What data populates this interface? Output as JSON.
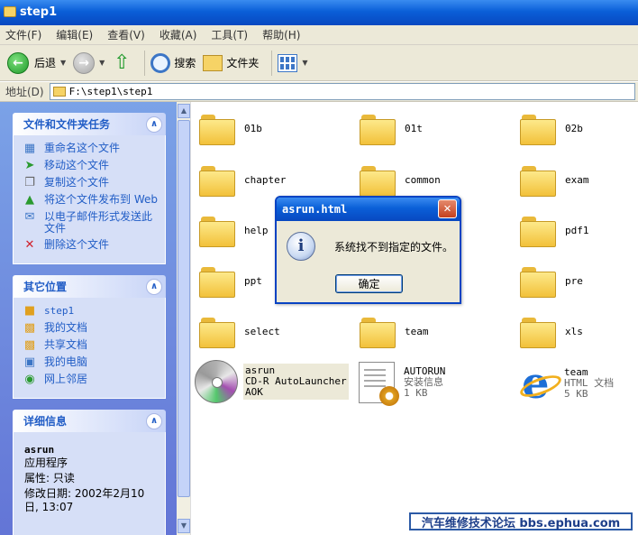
{
  "window": {
    "title": "step1"
  },
  "menu": [
    "文件(F)",
    "编辑(E)",
    "查看(V)",
    "收藏(A)",
    "工具(T)",
    "帮助(H)"
  ],
  "toolbar": {
    "back_label": "后退",
    "search_label": "搜索",
    "folders_label": "文件夹"
  },
  "address": {
    "label": "地址(D)",
    "path": "F:\\step1\\step1"
  },
  "sidebar": {
    "tasks": {
      "title": "文件和文件夹任务",
      "items": [
        {
          "label": "重命名这个文件",
          "icon": "rename-icon"
        },
        {
          "label": "移动这个文件",
          "icon": "move-icon"
        },
        {
          "label": "复制这个文件",
          "icon": "copy-icon"
        },
        {
          "label": "将这个文件发布到 Web",
          "icon": "publish-web-icon"
        },
        {
          "label": "以电子邮件形式发送此文件",
          "icon": "email-icon"
        },
        {
          "label": "删除这个文件",
          "icon": "delete-icon"
        }
      ]
    },
    "places": {
      "title": "其它位置",
      "items": [
        {
          "label": "step1",
          "icon": "folder-icon"
        },
        {
          "label": "我的文档",
          "icon": "my-documents-icon"
        },
        {
          "label": "共享文档",
          "icon": "shared-documents-icon"
        },
        {
          "label": "我的电脑",
          "icon": "my-computer-icon"
        },
        {
          "label": "网上邻居",
          "icon": "network-icon"
        }
      ]
    },
    "details": {
      "title": "详细信息",
      "name": "asrun",
      "type": "应用程序",
      "attr": "属性: 只读",
      "modified": "修改日期: 2002年2月10日, 13:07"
    }
  },
  "folders": [
    "01b",
    "01t",
    "02b",
    "chapter",
    "common",
    "exam",
    "help",
    "pdf1",
    "ppt",
    "pre",
    "select",
    "team",
    "xls"
  ],
  "files": [
    {
      "name": "asrun",
      "line2": "CD-R AutoLauncher",
      "line3": "AOK",
      "icon": "cd-icon"
    },
    {
      "name": "AUTORUN",
      "line2": "安装信息",
      "line3": "1 KB",
      "icon": "setup-info-icon"
    },
    {
      "name": "team",
      "line2": "HTML 文档",
      "line3": "5 KB",
      "icon": "ie-icon"
    }
  ],
  "dialog": {
    "title": "asrun.html",
    "message": "系统找不到指定的文件。",
    "ok_label": "确定",
    "icon": "info-icon"
  },
  "watermark": "汽车维修技术论坛 bbs.ephua.com"
}
